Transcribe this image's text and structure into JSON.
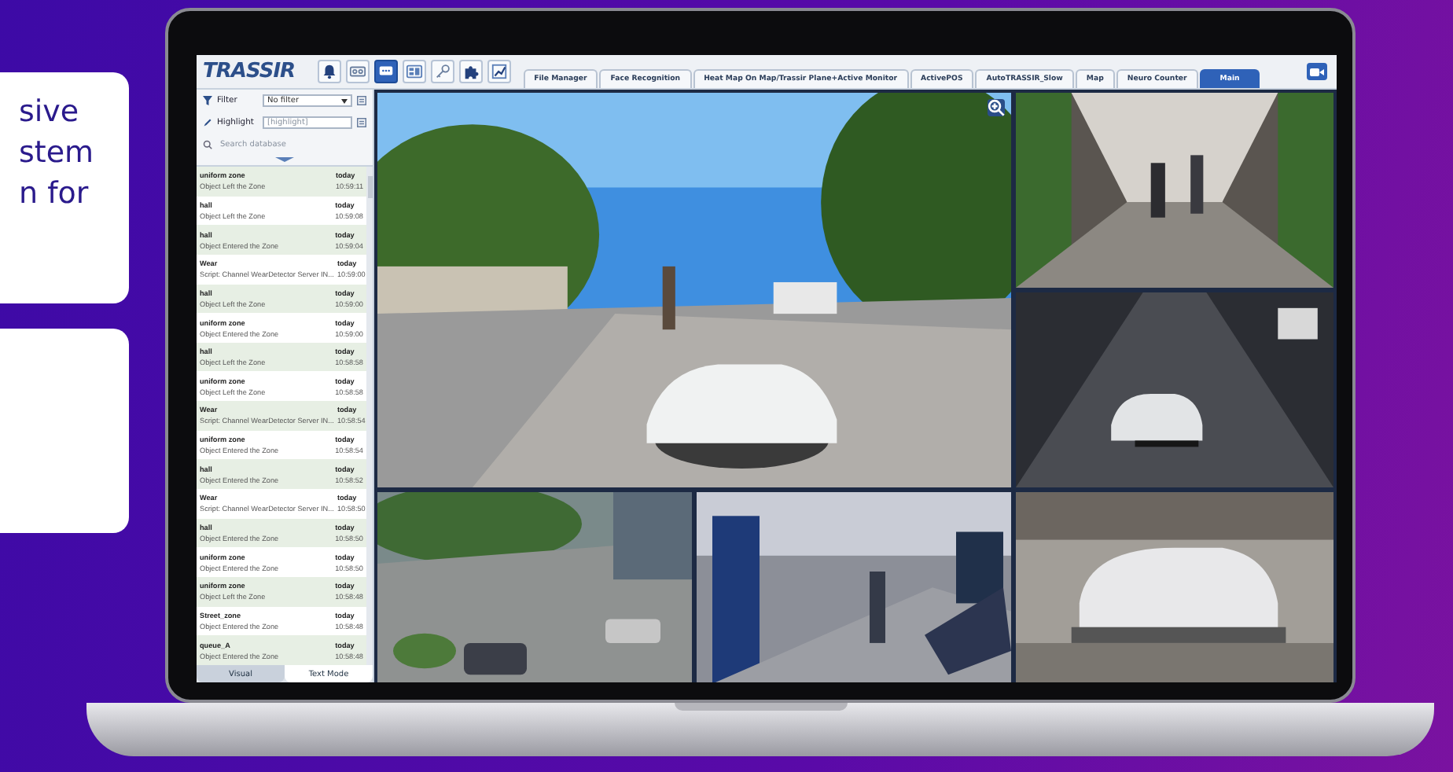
{
  "promo_cards": [
    {
      "kind": "text",
      "lines": [
        "sive",
        "stem",
        "n for"
      ]
    },
    {
      "kind": "blank"
    }
  ],
  "app": {
    "logo": "TRASSIR",
    "toolbar_buttons": [
      {
        "kind": "bell",
        "selected": false
      },
      {
        "kind": "tape",
        "selected": false
      },
      {
        "kind": "chat",
        "selected": true
      },
      {
        "kind": "layout",
        "selected": false
      },
      {
        "kind": "key",
        "selected": false
      },
      {
        "kind": "puzzle",
        "selected": false
      },
      {
        "kind": "chart",
        "selected": false
      }
    ],
    "tabs": [
      {
        "label": "File Manager",
        "selected": false
      },
      {
        "label": "Face Recognition",
        "selected": false
      },
      {
        "label": "Heat Map On Map/Trassir Plane+Active Monitor",
        "selected": false
      },
      {
        "label": "ActivePOS",
        "selected": false
      },
      {
        "label": "AutoTRASSIR_Slow",
        "selected": false
      },
      {
        "label": "Map",
        "selected": false
      },
      {
        "label": "Neuro Counter",
        "selected": false
      },
      {
        "label": "Main",
        "selected": true
      }
    ],
    "sidebar": {
      "filter": {
        "label": "Filter",
        "value": "No filter"
      },
      "highlight": {
        "label": "Highlight",
        "placeholder": "[highlight]"
      },
      "search": {
        "placeholder": "Search database"
      },
      "events": [
        {
          "title": "uniform zone",
          "day": "today",
          "message": "Object Left the Zone",
          "time": "10:59:11"
        },
        {
          "title": "hall",
          "day": "today",
          "message": "Object Left the Zone",
          "time": "10:59:08"
        },
        {
          "title": "hall",
          "day": "today",
          "message": "Object Entered the Zone",
          "time": "10:59:04"
        },
        {
          "title": "Wear",
          "day": "today",
          "message": "Script: Channel WearDetector Server IN...",
          "time": "10:59:00"
        },
        {
          "title": "hall",
          "day": "today",
          "message": "Object Left the Zone",
          "time": "10:59:00"
        },
        {
          "title": "uniform zone",
          "day": "today",
          "message": "Object Entered the Zone",
          "time": "10:59:00"
        },
        {
          "title": "hall",
          "day": "today",
          "message": "Object Left the Zone",
          "time": "10:58:58"
        },
        {
          "title": "uniform zone",
          "day": "today",
          "message": "Object Left the Zone",
          "time": "10:58:58"
        },
        {
          "title": "Wear",
          "day": "today",
          "message": "Script: Channel WearDetector Server IN...",
          "time": "10:58:54"
        },
        {
          "title": "uniform zone",
          "day": "today",
          "message": "Object Entered the Zone",
          "time": "10:58:54"
        },
        {
          "title": "hall",
          "day": "today",
          "message": "Object Entered the Zone",
          "time": "10:58:52"
        },
        {
          "title": "Wear",
          "day": "today",
          "message": "Script: Channel WearDetector Server IN...",
          "time": "10:58:50"
        },
        {
          "title": "hall",
          "day": "today",
          "message": "Object Entered the Zone",
          "time": "10:58:50"
        },
        {
          "title": "uniform zone",
          "day": "today",
          "message": "Object Entered the Zone",
          "time": "10:58:50"
        },
        {
          "title": "uniform zone",
          "day": "today",
          "message": "Object Left the Zone",
          "time": "10:58:48"
        },
        {
          "title": "Street_zone",
          "day": "today",
          "message": "Object Entered the Zone",
          "time": "10:58:48"
        },
        {
          "title": "queue_A",
          "day": "today",
          "message": "Object Entered the Zone",
          "time": "10:58:48"
        }
      ],
      "view_tabs": [
        {
          "label": "Visual",
          "selected": false
        },
        {
          "label": "Text Mode",
          "selected": true
        }
      ]
    }
  }
}
